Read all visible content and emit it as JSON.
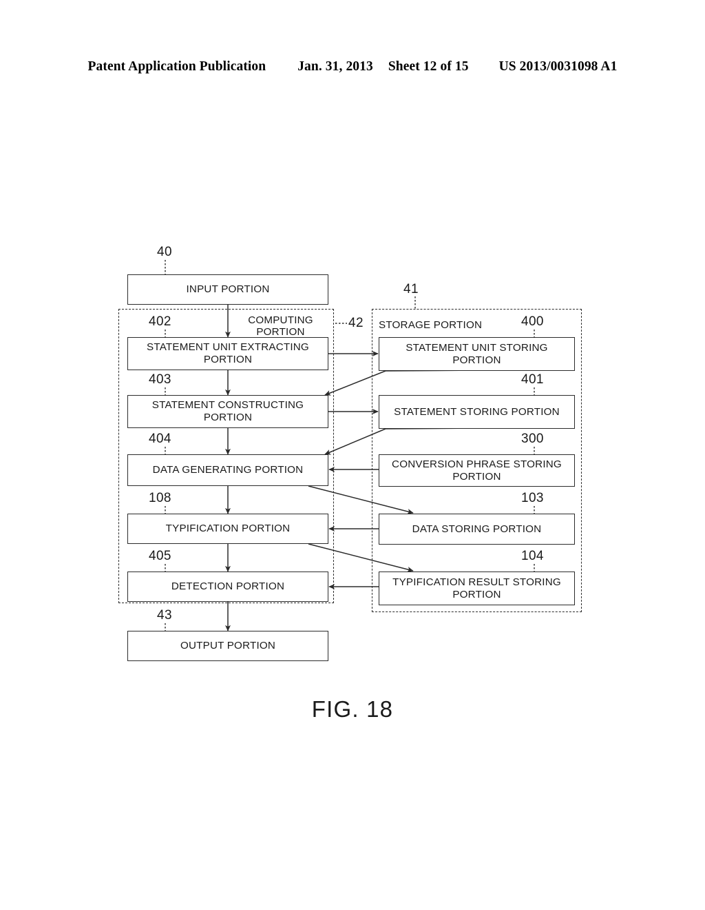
{
  "header": {
    "publication": "Patent Application Publication",
    "date": "Jan. 31, 2013",
    "sheet": "Sheet 12 of 15",
    "patent_number": "US 2013/0031098 A1"
  },
  "figure": {
    "caption": "FIG. 18"
  },
  "groups": {
    "computing": {
      "title": "COMPUTING\nPORTION",
      "ref": "42"
    },
    "storage": {
      "title": "STORAGE PORTION",
      "ref": "41"
    }
  },
  "nodes": {
    "input": {
      "label": "INPUT PORTION",
      "ref": "40"
    },
    "statement_unit_extracting": {
      "label": "STATEMENT UNIT EXTRACTING PORTION",
      "ref": "402"
    },
    "statement_constructing": {
      "label": "STATEMENT CONSTRUCTING PORTION",
      "ref": "403"
    },
    "data_generating": {
      "label": "DATA GENERATING PORTION",
      "ref": "404"
    },
    "typification": {
      "label": "TYPIFICATION PORTION",
      "ref": "108"
    },
    "detection": {
      "label": "DETECTION PORTION",
      "ref": "405"
    },
    "output": {
      "label": "OUTPUT PORTION",
      "ref": "43"
    },
    "statement_unit_storing": {
      "label": "STATEMENT UNIT STORING PORTION",
      "ref": "400"
    },
    "statement_storing": {
      "label": "STATEMENT STORING PORTION",
      "ref": "401"
    },
    "conversion_phrase_storing": {
      "label": "CONVERSION PHRASE STORING PORTION",
      "ref": "300"
    },
    "data_storing": {
      "label": "DATA STORING PORTION",
      "ref": "103"
    },
    "typification_result_storing": {
      "label": "TYPIFICATION RESULT STORING PORTION",
      "ref": "104"
    }
  },
  "colors": {
    "ink": "#1a1a1a",
    "stroke": "#2b2b2b",
    "background": "#ffffff"
  }
}
